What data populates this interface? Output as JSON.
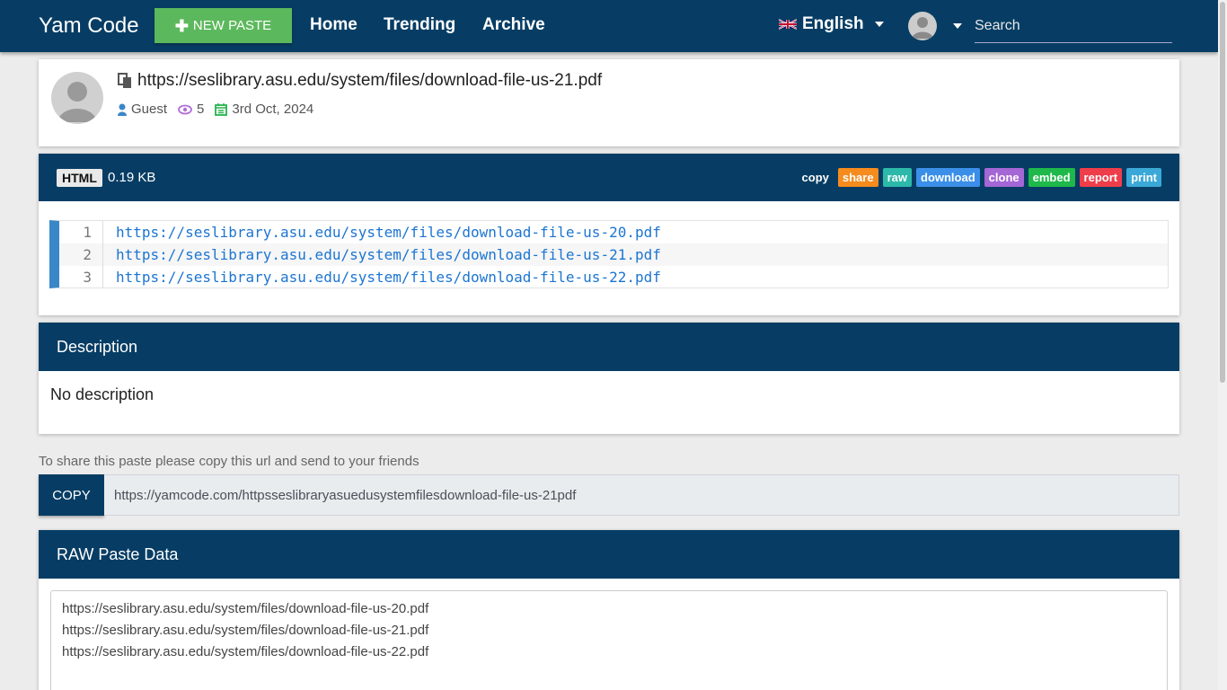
{
  "navbar": {
    "brand": "Yam Code",
    "new_paste": "NEW PASTE",
    "links": [
      "Home",
      "Trending",
      "Archive"
    ],
    "language": "English",
    "search_placeholder": "Search"
  },
  "paste": {
    "title": "https://seslibrary.asu.edu/system/files/download-file-us-21.pdf",
    "author": "Guest",
    "views": "5",
    "date": "3rd Oct, 2024",
    "language": "HTML",
    "size": "0.19 KB",
    "actions": [
      {
        "label": "copy",
        "color": "#073d64"
      },
      {
        "label": "share",
        "color": "#f68b1e"
      },
      {
        "label": "raw",
        "color": "#2cb9a9"
      },
      {
        "label": "download",
        "color": "#3b8fe8"
      },
      {
        "label": "clone",
        "color": "#a566d6"
      },
      {
        "label": "embed",
        "color": "#1fb84a"
      },
      {
        "label": "report",
        "color": "#ef3d4a"
      },
      {
        "label": "print",
        "color": "#3ba9d8"
      }
    ],
    "lines": [
      {
        "no": "1",
        "text": "https://seslibrary.asu.edu/system/files/download-file-us-20.pdf"
      },
      {
        "no": "2",
        "text": "https://seslibrary.asu.edu/system/files/download-file-us-21.pdf"
      },
      {
        "no": "3",
        "text": "https://seslibrary.asu.edu/system/files/download-file-us-22.pdf"
      }
    ]
  },
  "description": {
    "heading": "Description",
    "text": "No description"
  },
  "share": {
    "note": "To share this paste please copy this url and send to your friends",
    "copy_label": "COPY",
    "url": "https://yamcode.com/httpsseslibraryasuedusystemfilesdownload-file-us-21pdf"
  },
  "raw": {
    "heading": "RAW Paste Data",
    "text": "https://seslibrary.asu.edu/system/files/download-file-us-20.pdf\nhttps://seslibrary.asu.edu/system/files/download-file-us-21.pdf\nhttps://seslibrary.asu.edu/system/files/download-file-us-22.pdf"
  }
}
